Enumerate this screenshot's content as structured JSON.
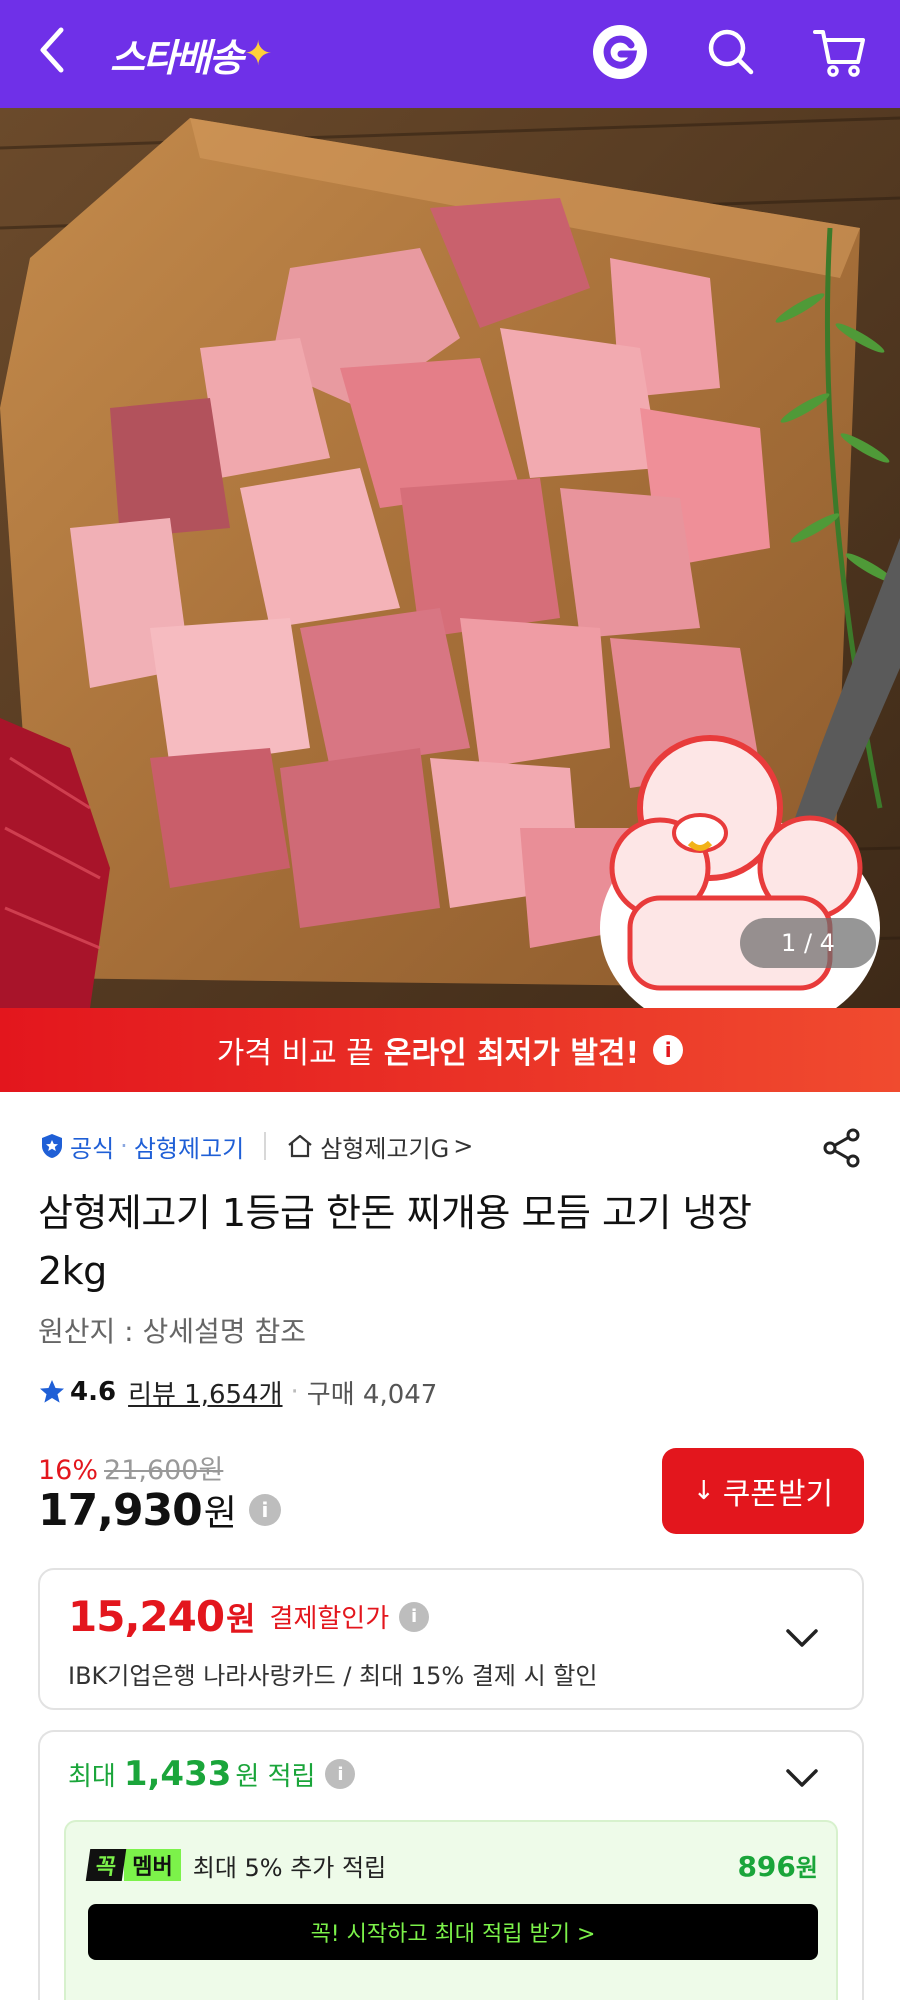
{
  "header": {
    "logo_text": "스타배송",
    "logo_spark": "✦",
    "icons": [
      "back-icon",
      "gmarket-g-icon",
      "search-icon",
      "cart-icon"
    ],
    "bg_color": "#6f30e8"
  },
  "gallery": {
    "current": "1",
    "separator": "/",
    "total": "4",
    "counter_text": "1 / 4"
  },
  "promo": {
    "plain": "가격 비교 끝",
    "strong": "온라인 최저가 발견!",
    "info": "i",
    "bg_color": "#e3161d"
  },
  "seller": {
    "official_label": "공식",
    "dot": "·",
    "name": "삼형제고기",
    "store_label": "삼형제고기G",
    "store_arrow": ">"
  },
  "product": {
    "title": "삼형제고기 1등급 한돈 찌개용 모듬 고기 냉장 2kg",
    "origin": "원산지 : 상세설명 참조"
  },
  "rating": {
    "score": "4.6",
    "review_text": "리뷰 1,654개",
    "dot": "·",
    "purchase_text": "구매 4,047"
  },
  "price": {
    "discount_rate": "16%",
    "original_price": "21,600원",
    "sale_price": "17,930",
    "unit": "원",
    "info": "i",
    "coupon_icon": "↓",
    "coupon_label": "쿠폰받기"
  },
  "card_discount": {
    "amount": "15,240",
    "unit": "원",
    "label": "결제할인가",
    "info": "i",
    "description": "IBK기업은행 나라사랑카드 / 최대 15% 결제 시 할인"
  },
  "reward": {
    "prefix": "최대",
    "amount": "1,433",
    "suffix": "원 적립",
    "info": "i",
    "member_badge_left": "꼭",
    "member_badge_right": "멤버",
    "member_desc": "최대 5% 추가 적립",
    "member_amount": "896",
    "member_unit": "원",
    "cta_label": "꼭! 시작하고 최대 적립 받기  >",
    "accent_color": "#1aa53a"
  }
}
